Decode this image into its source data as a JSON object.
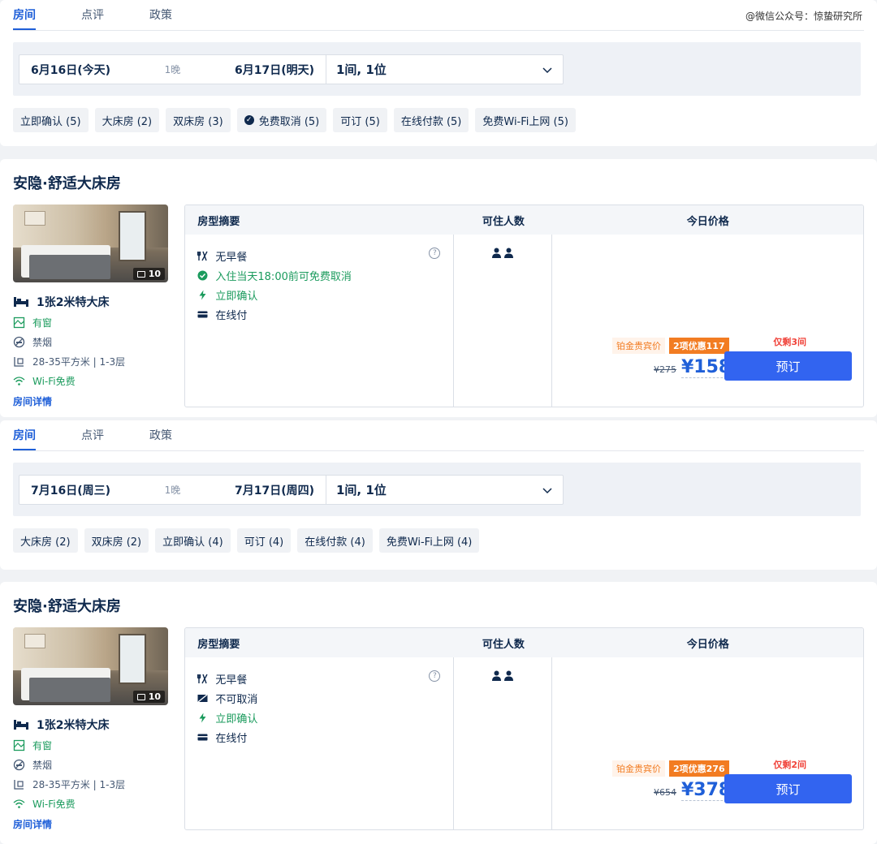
{
  "watermark": "@微信公众号：惊蛰研究所",
  "sections": [
    {
      "tabs": [
        "房间",
        "点评",
        "政策"
      ],
      "checkin": "6月16日(今天)",
      "nights": "1晚",
      "checkout": "6月17日(明天)",
      "guests": "1间, 1位",
      "filters": [
        {
          "label": "立即确认 (5)",
          "checked": false
        },
        {
          "label": "大床房 (2)",
          "checked": false
        },
        {
          "label": "双床房 (3)",
          "checked": false
        },
        {
          "label": "免费取消 (5)",
          "checked": true
        },
        {
          "label": "可订 (5)",
          "checked": false
        },
        {
          "label": "在线付款 (5)",
          "checked": false
        },
        {
          "label": "免费Wi-Fi上网 (5)",
          "checked": false
        }
      ],
      "room": {
        "title": "安隐·舒适大床房",
        "photo_count": "10",
        "bed": "1张2米特大床",
        "features": [
          {
            "icon": "window-icon",
            "text": "有窗",
            "green": true
          },
          {
            "icon": "no-smoking-icon",
            "text": "禁烟",
            "green": false
          },
          {
            "icon": "area-icon",
            "text": "28-35平方米 | 1-3层",
            "green": false
          },
          {
            "icon": "wifi-icon",
            "text": "Wi-Fi免费",
            "green": true
          }
        ],
        "detail_link": "房间详情",
        "headers": [
          "房型摘要",
          "可住人数",
          "今日价格"
        ],
        "policies": [
          {
            "icon": "breakfast-icon",
            "text": "无早餐",
            "green": false
          },
          {
            "icon": "check-circle-icon",
            "text": "入住当天18:00前可免费取消",
            "green": true
          },
          {
            "icon": "lightning-icon",
            "text": "立即确认",
            "green": true
          },
          {
            "icon": "card-icon",
            "text": "在线付",
            "green": false
          }
        ],
        "question": "?",
        "vip_tag": "铂金贵宾价",
        "discount_tag": "2项优惠117",
        "remaining": "仅剩3间",
        "original_price": "¥275",
        "price": "¥158",
        "book_label": "预订"
      }
    },
    {
      "tabs": [
        "房间",
        "点评",
        "政策"
      ],
      "checkin": "7月16日(周三)",
      "nights": "1晚",
      "checkout": "7月17日(周四)",
      "guests": "1间, 1位",
      "filters": [
        {
          "label": "大床房 (2)",
          "checked": false
        },
        {
          "label": "双床房 (2)",
          "checked": false
        },
        {
          "label": "立即确认 (4)",
          "checked": false
        },
        {
          "label": "可订 (4)",
          "checked": false
        },
        {
          "label": "在线付款 (4)",
          "checked": false
        },
        {
          "label": "免费Wi-Fi上网 (4)",
          "checked": false
        }
      ],
      "room": {
        "title": "安隐·舒适大床房",
        "photo_count": "10",
        "bed": "1张2米特大床",
        "features": [
          {
            "icon": "window-icon",
            "text": "有窗",
            "green": true
          },
          {
            "icon": "no-smoking-icon",
            "text": "禁烟",
            "green": false
          },
          {
            "icon": "area-icon",
            "text": "28-35平方米 | 1-3层",
            "green": false
          },
          {
            "icon": "wifi-icon",
            "text": "Wi-Fi免费",
            "green": true
          }
        ],
        "detail_link": "房间详情",
        "headers": [
          "房型摘要",
          "可住人数",
          "今日价格"
        ],
        "policies": [
          {
            "icon": "breakfast-icon",
            "text": "无早餐",
            "green": false
          },
          {
            "icon": "no-cancel-icon",
            "text": "不可取消",
            "green": false
          },
          {
            "icon": "lightning-icon",
            "text": "立即确认",
            "green": true
          },
          {
            "icon": "card-icon",
            "text": "在线付",
            "green": false
          }
        ],
        "question": "?",
        "vip_tag": "铂金贵宾价",
        "discount_tag": "2项优惠276",
        "remaining": "仅剩2间",
        "original_price": "¥654",
        "price": "¥378",
        "book_label": "预订"
      }
    }
  ]
}
